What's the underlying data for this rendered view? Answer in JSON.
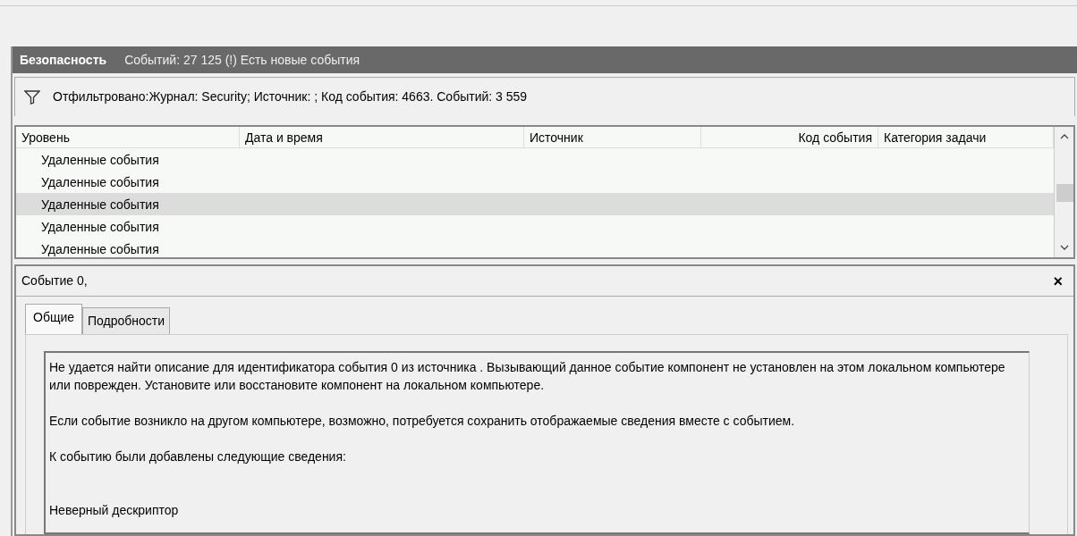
{
  "header": {
    "title": "Безопасность",
    "info": "Событий: 27 125 (!) Есть новые события"
  },
  "filter": {
    "text": "Отфильтровано:Журнал: Security; Источник: ; Код события: 4663. Событий: 3 559"
  },
  "table": {
    "columns": [
      "Уровень",
      "Дата и время",
      "Источник",
      "Код события",
      "Категория задачи"
    ],
    "rows": [
      {
        "level": "Удаленные события",
        "selected": false
      },
      {
        "level": "Удаленные события",
        "selected": false
      },
      {
        "level": "Удаленные события",
        "selected": true
      },
      {
        "level": "Удаленные события",
        "selected": false
      },
      {
        "level": "Удаленные события",
        "selected": false
      }
    ]
  },
  "details": {
    "title": "Событие 0,",
    "close": "×",
    "tabs": [
      {
        "label": "Общие",
        "selected": true
      },
      {
        "label": "Подробности",
        "selected": false
      }
    ],
    "paragraphs": [
      "Не удается найти описание для идентификатора события 0 из источника . Вызывающий данное событие компонент не установлен на этом локальном компьютере или поврежден. Установите или восстановите компонент на локальном компьютере.",
      "Если событие возникло на другом компьютере, возможно, потребуется сохранить отображаемые сведения вместе с событием.",
      "К событию были добавлены следующие сведения:",
      "Неверный дескриптор"
    ]
  }
}
